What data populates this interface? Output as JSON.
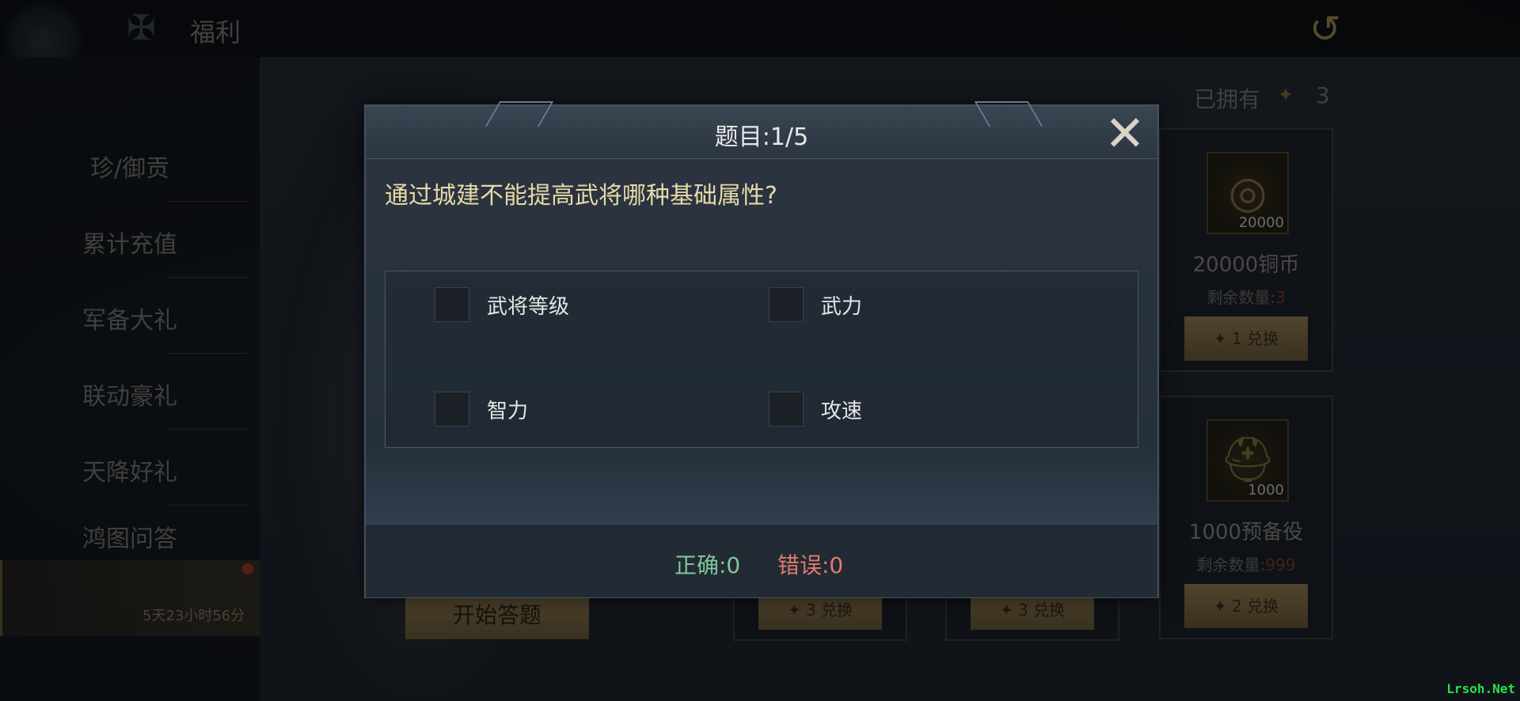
{
  "topbar": {
    "title": "福利"
  },
  "sidebar": {
    "items": [
      {
        "label": "珍/御贡"
      },
      {
        "label": "累计充值"
      },
      {
        "label": "军备大礼"
      },
      {
        "label": "联动豪礼"
      },
      {
        "label": "天降好礼"
      },
      {
        "label": "鸿图问答",
        "timer": "5天23小时56分",
        "active": true
      }
    ]
  },
  "main": {
    "start_button": "开始答题",
    "owned_label": "已拥有",
    "owned_count": "3",
    "rewards": [
      {
        "name": "20000铜币",
        "qty": "20000",
        "remain_label": "剩余数量:",
        "remain": "3",
        "cost": "1",
        "exchange_label": "兑换",
        "icon": "coin-icon"
      },
      {
        "name": "1000预备役",
        "qty": "1000",
        "remain_label": "剩余数量:",
        "remain": "999",
        "cost": "2",
        "exchange_label": "兑换",
        "icon": "helmet-icon"
      }
    ],
    "bottom_cards": [
      {
        "cost": "3",
        "exchange_label": "兑换"
      },
      {
        "cost": "3",
        "exchange_label": "兑换"
      }
    ]
  },
  "dialog": {
    "title": "题目:1/5",
    "question": "通过城建不能提高武将哪种基础属性?",
    "options": [
      {
        "label": "武将等级",
        "checked": false
      },
      {
        "label": "武力",
        "checked": false
      },
      {
        "label": "智力",
        "checked": false
      },
      {
        "label": "攻速",
        "checked": false
      }
    ],
    "correct": "正确:0",
    "wrong": "错误:0"
  },
  "watermark": "Lrsoh.Net",
  "colors": {
    "accent_gold": "#9a8558",
    "correct_green": "#7fc89a",
    "wrong_red": "#e07a72"
  }
}
